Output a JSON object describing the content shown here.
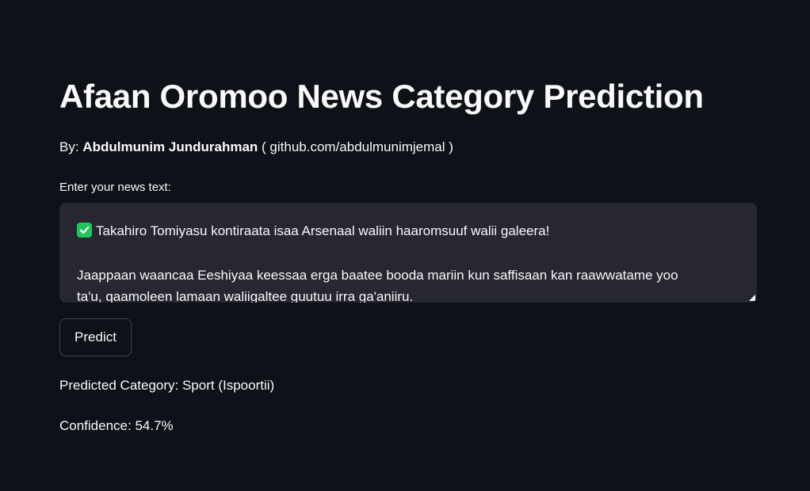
{
  "header": {
    "title": "Afaan Oromoo News Category Prediction"
  },
  "byline": {
    "prefix": "By:",
    "author": "Abdulmunim Jundurahman",
    "link": "( github.com/abdulmunimjemal )"
  },
  "input": {
    "label": "Enter your news text:",
    "line1": "Takahiro Tomiyasu kontiraata isaa Arsenaal waliin haaromsuuf walii galeera!",
    "line2": "Jaappaan waancaa Eeshiyaa keessaa erga baatee booda mariin kun saffisaan kan raawwatame yoo",
    "line3": "ta'u, qaamoleen lamaan waliigaltee guutuu irra ga'aniiru.",
    "lead_icon": "green-check-emoji"
  },
  "actions": {
    "predict_label": "Predict"
  },
  "results": {
    "category": "Predicted Category: Sport (Ispoortii)",
    "confidence": "Confidence: 54.7%"
  },
  "colors": {
    "background": "#0e1117",
    "textarea": "#262730",
    "text": "#fafafa",
    "check": "#22c55e"
  }
}
